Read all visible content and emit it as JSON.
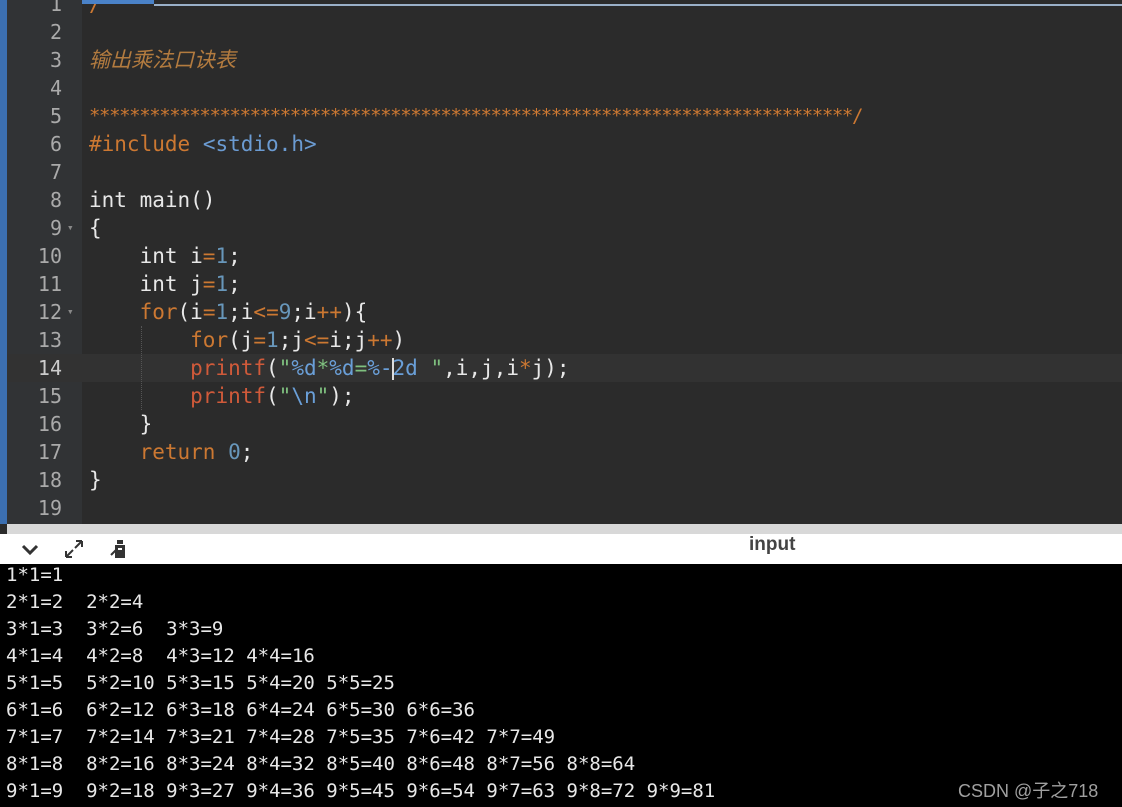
{
  "editor": {
    "lines": [
      {
        "n": "1"
      },
      {
        "n": "2"
      },
      {
        "n": "3",
        "comment": "输出乘法口诀表"
      },
      {
        "n": "4"
      },
      {
        "n": "5",
        "stars": "****************************************************************************/"
      },
      {
        "n": "6",
        "pp": "#include",
        "header": "<stdio.h>"
      },
      {
        "n": "7"
      },
      {
        "n": "8",
        "text": "int main()"
      },
      {
        "n": "9",
        "text": "{"
      },
      {
        "n": "10"
      },
      {
        "n": "11"
      },
      {
        "n": "12"
      },
      {
        "n": "13"
      },
      {
        "n": "14"
      },
      {
        "n": "15"
      },
      {
        "n": "16",
        "text": "    }"
      },
      {
        "n": "17"
      },
      {
        "n": "18",
        "text": "}"
      },
      {
        "n": "19"
      }
    ],
    "line1_fragment": "/"
  },
  "toolbar": {
    "collapse_icon": "chevron-down-icon",
    "expand_icon": "expand-icon",
    "clear_icon": "clear-console-icon",
    "title": "input"
  },
  "console": {
    "rows": [
      "1*1=1",
      "2*1=2  2*2=4",
      "3*1=3  3*2=6  3*3=9",
      "4*1=4  4*2=8  4*3=12 4*4=16",
      "5*1=5  5*2=10 5*3=15 5*4=20 5*5=25",
      "6*1=6  6*2=12 6*3=18 6*4=24 6*5=30 6*6=36",
      "7*1=7  7*2=14 7*3=21 7*4=28 7*5=35 7*6=42 7*7=49",
      "8*1=8  8*2=16 8*3=24 8*4=32 8*5=40 8*6=48 8*7=56 8*8=64",
      "9*1=9  9*2=18 9*3=27 9*4=36 9*5=45 9*6=54 9*7=63 9*8=72 9*9=81"
    ]
  },
  "watermark": "CSDN @子之718"
}
